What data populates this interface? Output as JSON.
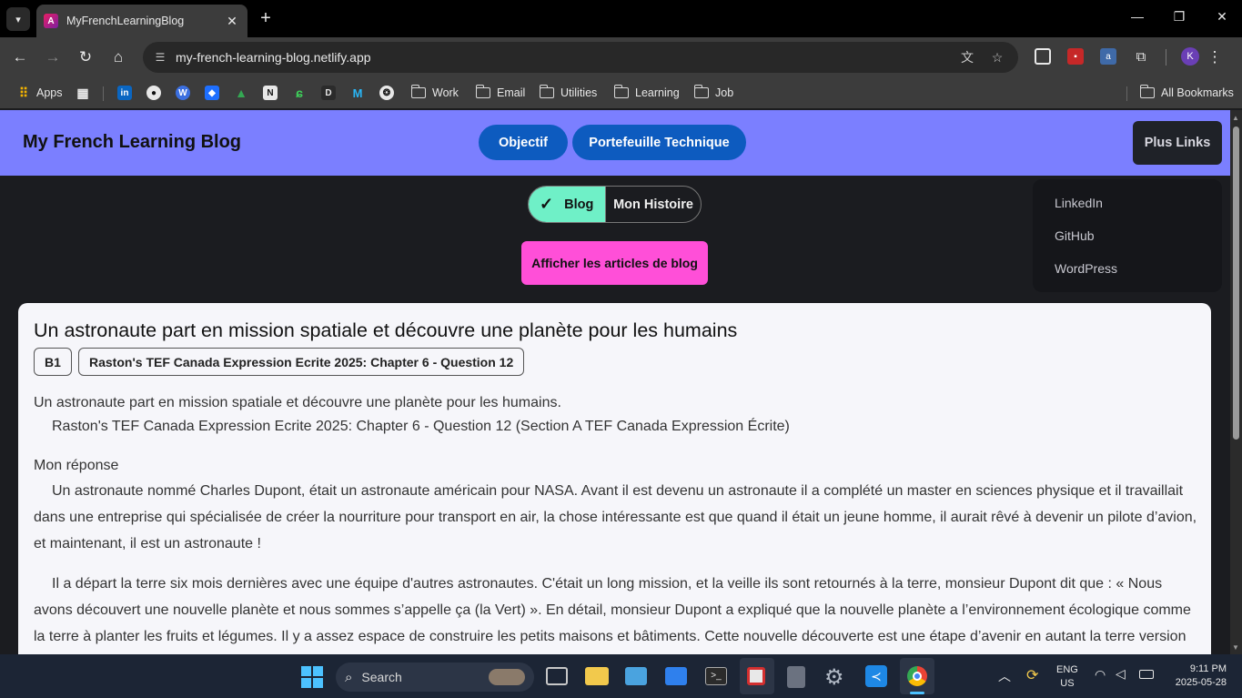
{
  "browser": {
    "tab_title": "MyFrenchLearningBlog",
    "tab_favicon_letter": "A",
    "url": "my-french-learning-blog.netlify.app",
    "profile_initial": "K"
  },
  "bookmarks": {
    "apps_label": "Apps",
    "folders": [
      "Work",
      "Email",
      "Utilities",
      "Learning",
      "Job"
    ],
    "all_bookmarks_label": "All Bookmarks"
  },
  "site": {
    "title": "My French Learning Blog",
    "nav": [
      "Objectif",
      "Portefeuille Technique"
    ],
    "more_links_label": "Plus Links",
    "dropdown": [
      "LinkedIn",
      "GitHub",
      "WordPress"
    ],
    "toggle": {
      "blog": "Blog",
      "history": "Mon Histoire"
    },
    "show_posts_label": "Afficher les articles de blog"
  },
  "post": {
    "title": "Un astronaute part en mission spatiale et découvre une planète pour les humains",
    "tags": [
      "B1",
      "Raston's TEF Canada Expression Ecrite 2025: Chapter 6 - Question 12"
    ],
    "intro_line1": "Un astronaute part en mission spatiale et découvre une planète pour les humains.",
    "intro_line2": "Raston's TEF Canada Expression Ecrite 2025: Chapter 6 - Question 12 (Section A TEF Canada Expression Écrite)",
    "answer_heading": "Mon réponse",
    "paragraphs": [
      "Un astronaute nommé Charles Dupont, était un astronaute américain pour NASA. Avant il est devenu un astronaute il a complété un master en sciences physique et il travaillait dans une entreprise qui spécialisée de créer la nourriture pour transport en air, la chose intéressante est que quand il était un jeune homme, il aurait rêvé à devenir un pilote d’avion, et maintenant, il est un astronaute !",
      "Il a départ la terre six mois dernières avec une équipe d'autres astronautes. C'était un long mission, et la veille ils sont retournés à la terre, monsieur Dupont dit que : « Nous avons découvert une nouvelle planète et nous sommes s’appelle ça (la Vert) ». En détail, monsieur Dupont a expliqué que la nouvelle planète a l’environnement écologique comme la terre à planter les fruits et légumes. Il y a assez espace de construire les petits maisons et bâtiments. Cette nouvelle découverte est une étape d’avenir en autant la terre version Deux !"
    ]
  },
  "taskbar": {
    "search_label": "Search",
    "lang_line1": "ENG",
    "lang_line2": "US",
    "time": "9:11 PM",
    "date": "2025-05-28"
  },
  "colors": {
    "header_bg": "#7b7fff",
    "nav_pill": "#0d5bbf",
    "toggle_active": "#6ff0c7",
    "show_posts_btn": "#ff4fd8"
  }
}
